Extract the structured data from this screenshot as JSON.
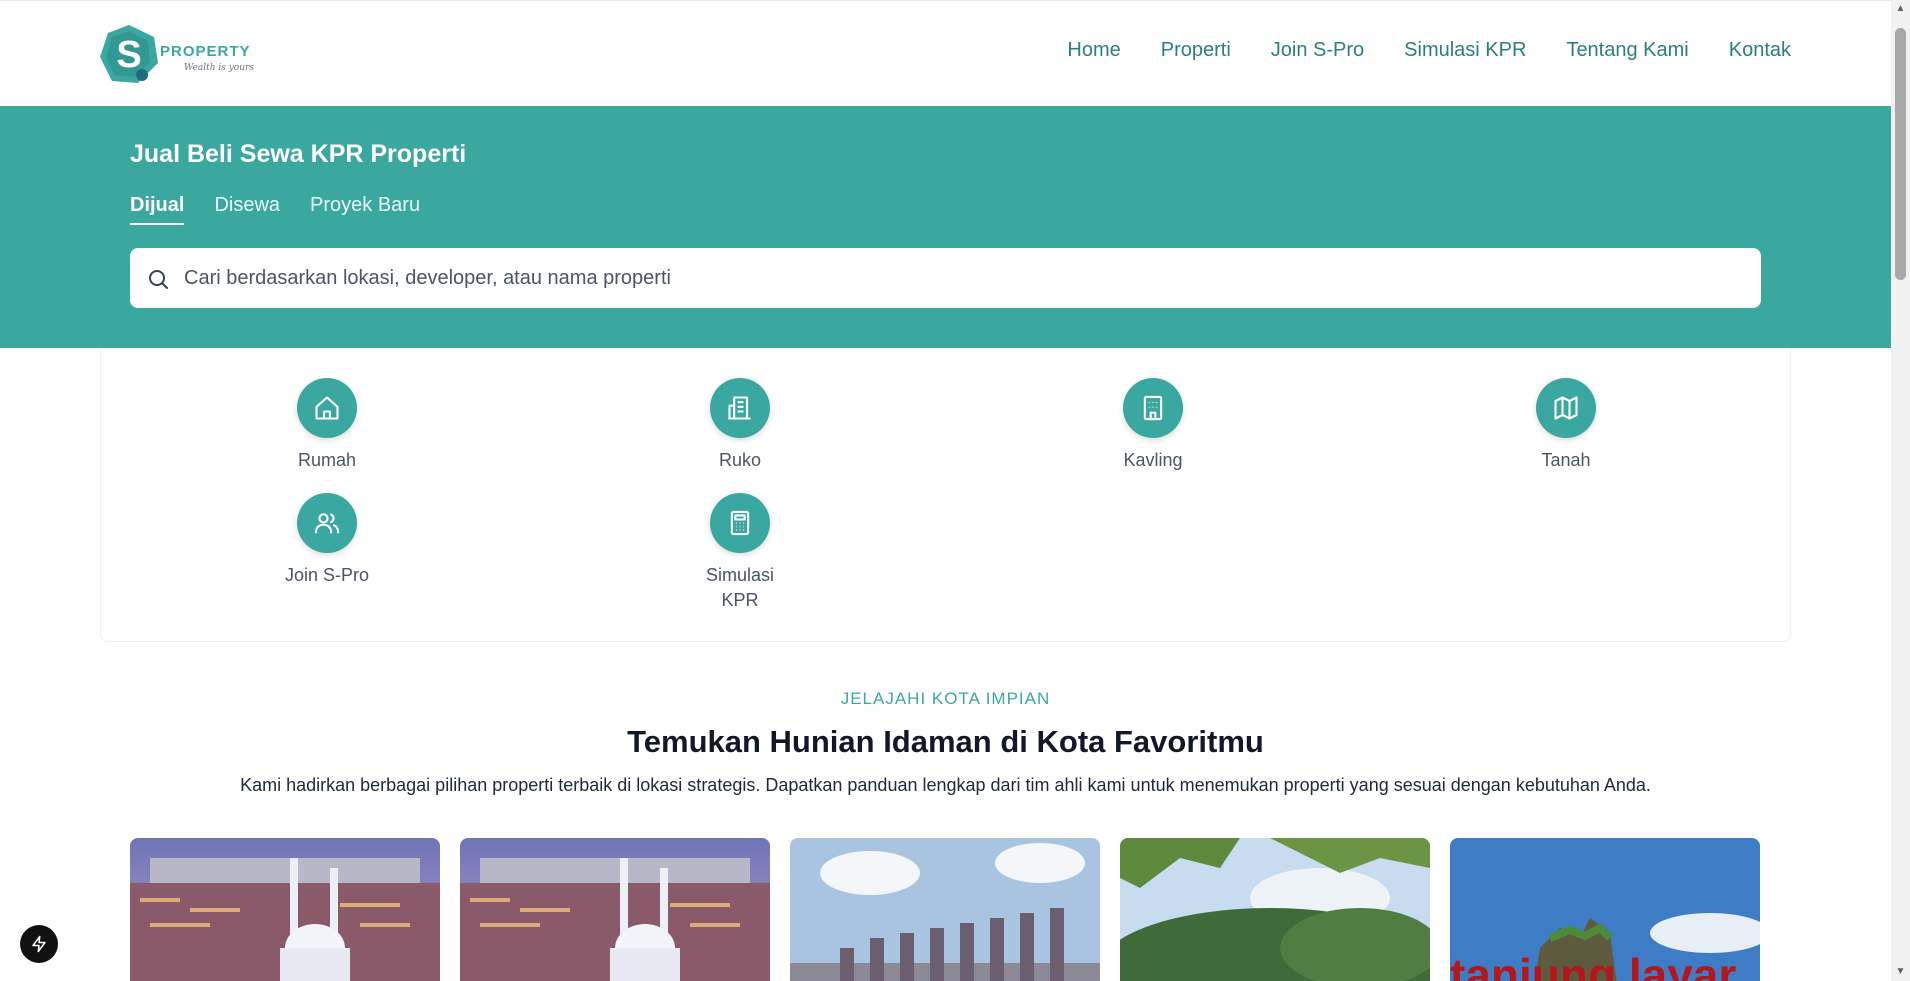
{
  "brand": {
    "wordmark": "PROPERTY",
    "tagline": "Wealth is yours"
  },
  "nav": {
    "items": [
      "Home",
      "Properti",
      "Join S-Pro",
      "Simulasi KPR",
      "Tentang Kami",
      "Kontak"
    ]
  },
  "hero": {
    "title": "Jual Beli Sewa KPR Properti",
    "tabs": [
      {
        "label": "Dijual",
        "active": true
      },
      {
        "label": "Disewa",
        "active": false
      },
      {
        "label": "Proyek Baru",
        "active": false
      }
    ],
    "search_placeholder": "Cari berdasarkan lokasi, developer, atau nama properti",
    "search_icon": "search-icon"
  },
  "categories": [
    {
      "label": "Rumah",
      "icon": "home-icon"
    },
    {
      "label": "Ruko",
      "icon": "building-icon"
    },
    {
      "label": "Kavling",
      "icon": "office-building-icon"
    },
    {
      "label": "Tanah",
      "icon": "map-icon"
    },
    {
      "label": "Join S-Pro",
      "icon": "users-icon"
    },
    {
      "label": "Simulasi KPR",
      "icon": "calculator-icon"
    }
  ],
  "section": {
    "eyebrow": "JELAJAHI KOTA IMPIAN",
    "headline": "Temukan Hunian Idaman di Kota Favoritmu",
    "subline": "Kami hadirkan berbagai pilihan properti terbaik di lokasi strategis. Dapatkan panduan lengkap dari tim ahli kami untuk menemukan properti yang sesuai dengan kebutuhan Anda."
  },
  "city_cards": [
    {
      "image": "mosque-city-night-photo"
    },
    {
      "image": "mosque-city-night-photo"
    },
    {
      "image": "monument-pillars-photo"
    },
    {
      "image": "forest-lake-photo"
    },
    {
      "image": "rock-island-sea-photo",
      "overlay_text": "tanjung layar"
    }
  ],
  "colors": {
    "accent": "#3ba8a0",
    "nav_text": "#2b7f7c",
    "fab": "#111111"
  },
  "fab_icon": "lightning-icon"
}
